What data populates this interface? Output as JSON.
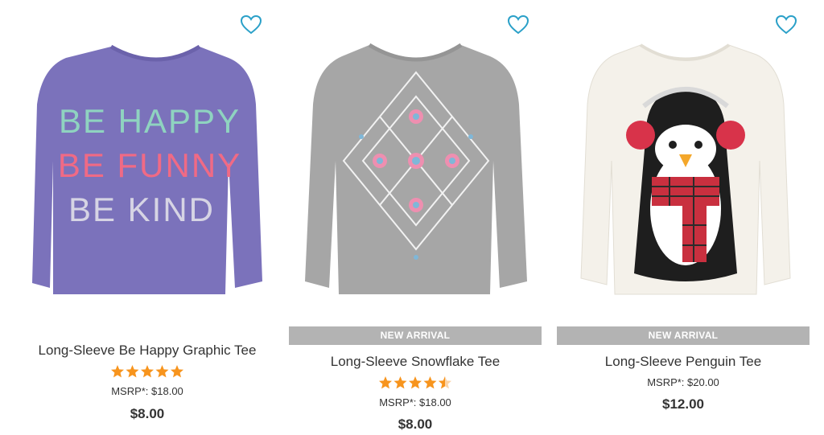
{
  "colors": {
    "accent": "#2aa0c8",
    "badge_bg": "#b3b3b3",
    "badge_text": "#ffffff",
    "star": "#f7941d",
    "text": "#333333"
  },
  "products": [
    {
      "name": "Long-Sleeve Be Happy Graphic Tee",
      "badge": "",
      "rating": 5,
      "msrp": "MSRP*: $18.00",
      "price": "$8.00",
      "shirt_color": "#7b72bb",
      "graphic_lines": [
        "BE HAPPY",
        "BE FUNNY",
        "BE KIND"
      ],
      "graphic_colors": [
        "#8fd3c0",
        "#f06a85",
        "#c9c7d8"
      ],
      "icon": "heart-icon"
    },
    {
      "name": "Long-Sleeve Snowflake Tee",
      "badge": "NEW ARRIVAL",
      "rating": 4.5,
      "msrp": "MSRP*: $18.00",
      "price": "$8.00",
      "shirt_color": "#a6a6a6",
      "graphic_lines": [],
      "graphic_colors": [],
      "icon": "heart-icon"
    },
    {
      "name": "Long-Sleeve Penguin Tee",
      "badge": "NEW ARRIVAL",
      "rating": null,
      "msrp": "MSRP*: $20.00",
      "price": "$12.00",
      "shirt_color": "#f4f1ea",
      "graphic_lines": [],
      "graphic_colors": [],
      "icon": "heart-icon"
    }
  ]
}
